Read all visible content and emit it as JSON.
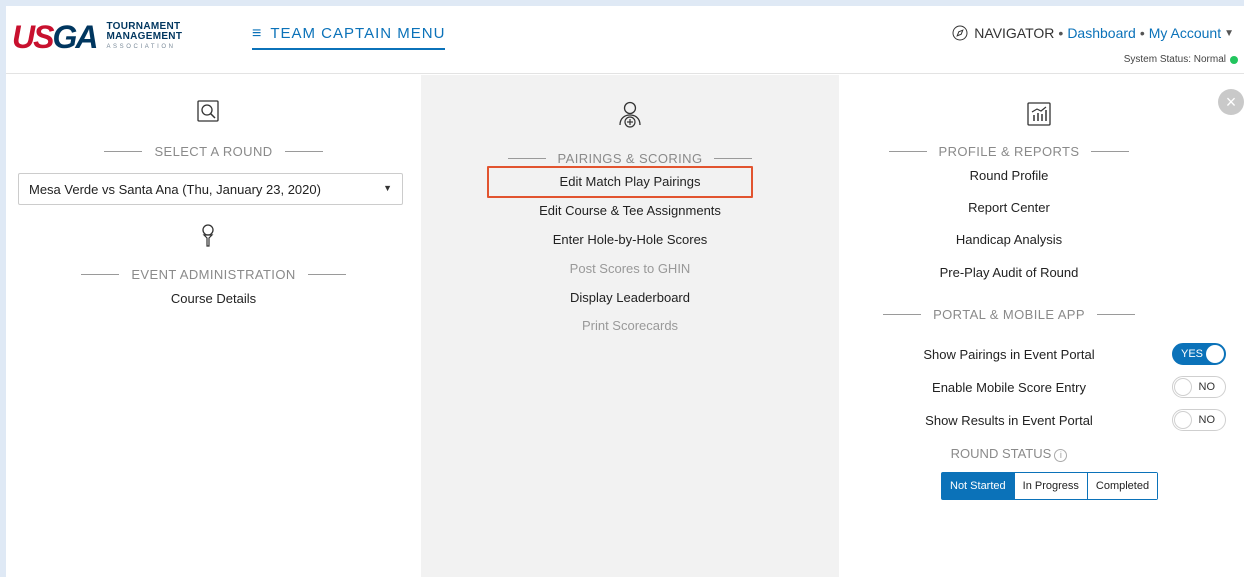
{
  "header": {
    "logo": {
      "mark_red": "US",
      "mark_blue": "GA",
      "line1": "TOURNAMENT",
      "line2": "MANAGEMENT",
      "line3": "ASSOCIATION"
    },
    "menu_label": "TEAM CAPTAIN MENU",
    "navigator_label": "NAVIGATOR",
    "dashboard_label": "Dashboard",
    "account_label": "My Account",
    "separator": "•",
    "system_status": "System Status: Normal",
    "colors": {
      "accent": "#0b72b9",
      "brand_red": "#c8102e",
      "brand_navy": "#00365f",
      "status_ok": "#22c55e"
    }
  },
  "left": {
    "round_heading": "SELECT A ROUND",
    "round_value": "Mesa Verde vs Santa Ana (Thu, January 23, 2020)",
    "event_heading": "EVENT ADMINISTRATION",
    "event_items": [
      "Course Details"
    ]
  },
  "middle": {
    "heading": "PAIRINGS & SCORING",
    "items": [
      {
        "label": "Edit Match Play Pairings",
        "disabled": false
      },
      {
        "label": "Edit Course & Tee Assignments",
        "disabled": false
      },
      {
        "label": "Enter Hole-by-Hole Scores",
        "disabled": false
      },
      {
        "label": "Post Scores to GHIN",
        "disabled": true
      },
      {
        "label": "Display Leaderboard",
        "disabled": false
      },
      {
        "label": "Print Scorecards",
        "disabled": true
      }
    ]
  },
  "right": {
    "reports_heading": "PROFILE & REPORTS",
    "reports_items": [
      "Round Profile",
      "Report Center",
      "Handicap Analysis",
      "Pre-Play Audit of Round"
    ],
    "portal_heading": "PORTAL & MOBILE APP",
    "toggles": [
      {
        "label": "Show Pairings in Event Portal",
        "value": "YES",
        "on": true
      },
      {
        "label": "Enable Mobile Score Entry",
        "value": "NO",
        "on": false
      },
      {
        "label": "Show Results in Event Portal",
        "value": "NO",
        "on": false
      }
    ],
    "round_status_label": "ROUND STATUS",
    "round_status_info": "i",
    "status_options": [
      "Not Started",
      "In Progress",
      "Completed"
    ],
    "status_selected": "Not Started",
    "close_symbol": "×"
  }
}
